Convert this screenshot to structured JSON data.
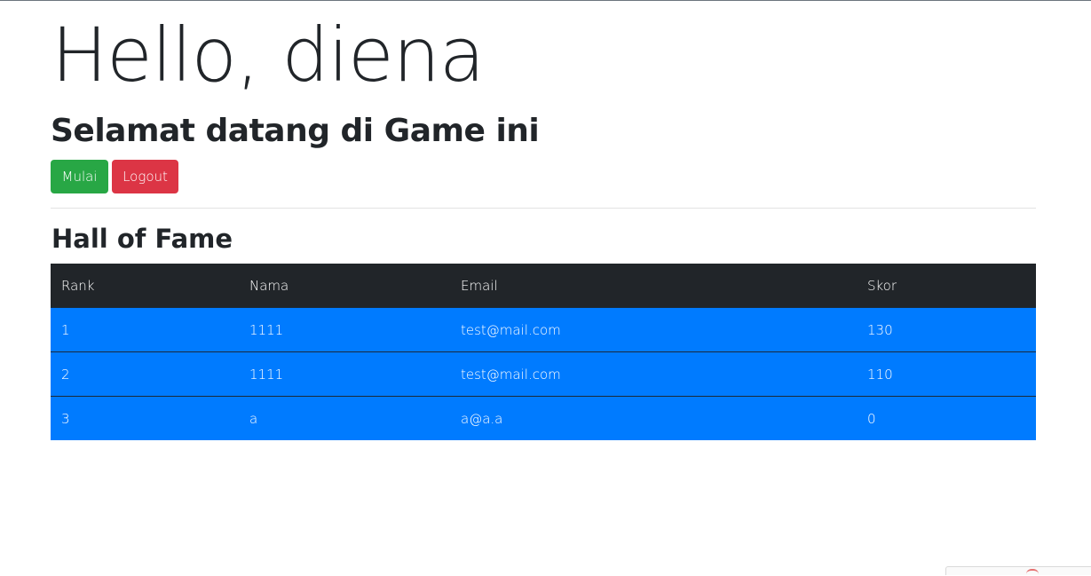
{
  "header": {
    "greeting": "Hello, diena",
    "welcome": "Selamat datang di Game ini"
  },
  "actions": {
    "start_label": "Mulai",
    "logout_label": "Logout",
    "start_color": "#28a745",
    "logout_color": "#dc3545"
  },
  "hall_of_fame": {
    "title": "Hall of Fame",
    "columns": [
      "Rank",
      "Nama",
      "Email",
      "Skor"
    ],
    "rows": [
      {
        "rank": "1",
        "nama": "1111",
        "email": "test@mail.com",
        "skor": "130"
      },
      {
        "rank": "2",
        "nama": "1111",
        "email": "test@mail.com",
        "skor": "110"
      },
      {
        "rank": "3",
        "nama": "a",
        "email": "a@a.a",
        "skor": "0"
      }
    ],
    "header_color": "#212529",
    "row_color": "#007bff"
  },
  "widgets": {
    "corner_icon": "recaptcha-badge-icon"
  }
}
